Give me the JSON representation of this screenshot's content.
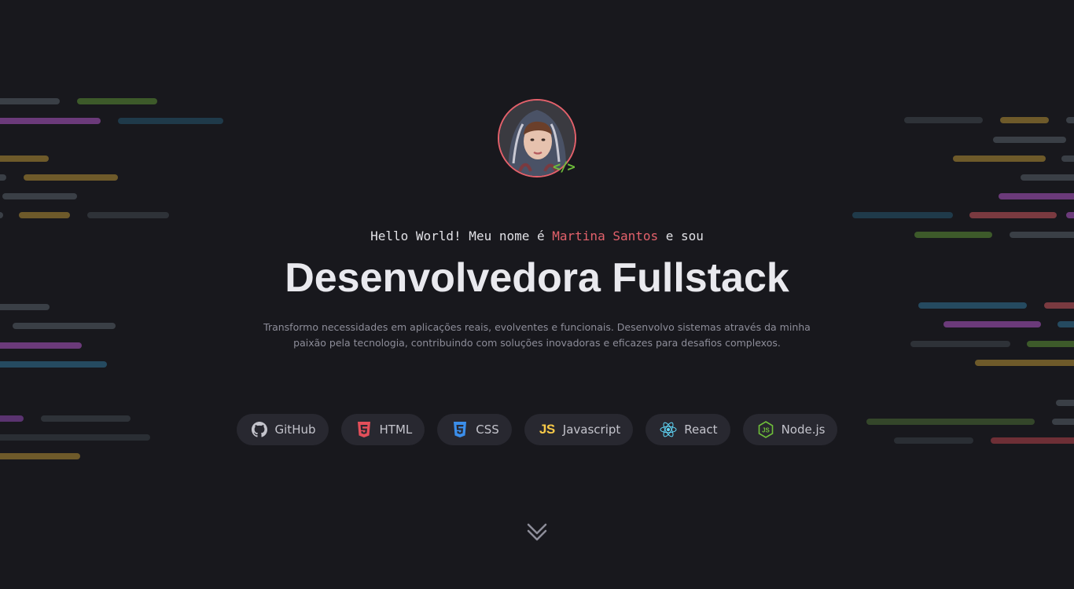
{
  "hero": {
    "greeting_prefix": "Hello World! Meu nome é ",
    "name": "Martina Santos",
    "greeting_suffix": " e sou",
    "title": "Desenvolvedora Fullstack",
    "description": "Transformo necessidades em aplicações reais, evolventes e funcionais. Desenvolvo sistemas através da minha paixão pela tecnologia, contribuindo com soluções inovadoras e eficazes para desafios complexos.",
    "code_badge": "</>"
  },
  "techs": [
    {
      "label": "GitHub",
      "icon": "github-icon"
    },
    {
      "label": "HTML",
      "icon": "html5-icon"
    },
    {
      "label": "CSS",
      "icon": "css3-icon"
    },
    {
      "label": "Javascript",
      "icon": "javascript-icon",
      "icon_text": "JS"
    },
    {
      "label": "React",
      "icon": "react-icon"
    },
    {
      "label": "Node.js",
      "icon": "nodejs-icon"
    }
  ],
  "colors": {
    "background": "#18181d",
    "accent": "#e3616b",
    "code_green": "#6fbf3a",
    "chip": "#282830",
    "html": "#e34f5a",
    "css": "#3b8eea",
    "js": "#f7c948",
    "react": "#61dafb",
    "node": "#6fbf3a"
  },
  "scroll_icon": "chevrons-down-icon"
}
